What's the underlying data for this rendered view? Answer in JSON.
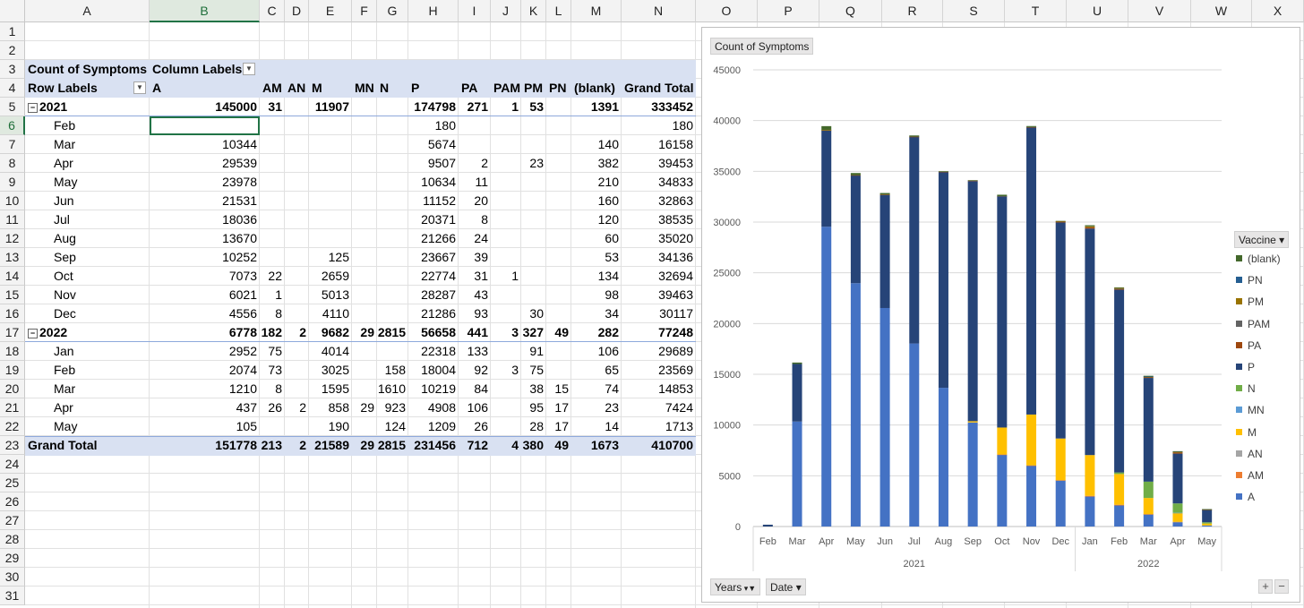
{
  "sheet": {
    "columns": [
      "A",
      "B",
      "C",
      "D",
      "E",
      "F",
      "G",
      "H",
      "I",
      "J",
      "K",
      "L",
      "M",
      "N",
      "O",
      "P",
      "Q",
      "R",
      "S",
      "T",
      "U",
      "V",
      "W",
      "X"
    ],
    "rows": [
      "1",
      "2",
      "3",
      "4",
      "5",
      "6",
      "7",
      "8",
      "9",
      "10",
      "11",
      "12",
      "13",
      "14",
      "15",
      "16",
      "17",
      "18",
      "19",
      "20",
      "21",
      "22",
      "23",
      "24",
      "25",
      "26",
      "27",
      "28",
      "29",
      "30",
      "31"
    ],
    "selected_column": "B",
    "selected_row": "6"
  },
  "pivot": {
    "count_label": "Count of Symptoms",
    "column_labels": "Column Labels",
    "row_labels": "Row Labels",
    "headers": [
      "A",
      "AM",
      "AN",
      "M",
      "MN",
      "N",
      "P",
      "PA",
      "PAM",
      "PM",
      "PN",
      "(blank)",
      "Grand Total"
    ],
    "rows": [
      {
        "label": "2021",
        "type": "year",
        "values": [
          "145000",
          "31",
          "",
          "11907",
          "",
          "",
          "174798",
          "271",
          "1",
          "53",
          "",
          "1391",
          "333452"
        ]
      },
      {
        "label": "Feb",
        "type": "month",
        "values": [
          "",
          "",
          "",
          "",
          "",
          "",
          "180",
          "",
          "",
          "",
          "",
          "",
          "180"
        ]
      },
      {
        "label": "Mar",
        "type": "month",
        "values": [
          "10344",
          "",
          "",
          "",
          "",
          "",
          "5674",
          "",
          "",
          "",
          "",
          "140",
          "16158"
        ]
      },
      {
        "label": "Apr",
        "type": "month",
        "values": [
          "29539",
          "",
          "",
          "",
          "",
          "",
          "9507",
          "2",
          "",
          "23",
          "",
          "382",
          "39453"
        ]
      },
      {
        "label": "May",
        "type": "month",
        "values": [
          "23978",
          "",
          "",
          "",
          "",
          "",
          "10634",
          "11",
          "",
          "",
          "",
          "210",
          "34833"
        ]
      },
      {
        "label": "Jun",
        "type": "month",
        "values": [
          "21531",
          "",
          "",
          "",
          "",
          "",
          "11152",
          "20",
          "",
          "",
          "",
          "160",
          "32863"
        ]
      },
      {
        "label": "Jul",
        "type": "month",
        "values": [
          "18036",
          "",
          "",
          "",
          "",
          "",
          "20371",
          "8",
          "",
          "",
          "",
          "120",
          "38535"
        ]
      },
      {
        "label": "Aug",
        "type": "month",
        "values": [
          "13670",
          "",
          "",
          "",
          "",
          "",
          "21266",
          "24",
          "",
          "",
          "",
          "60",
          "35020"
        ]
      },
      {
        "label": "Sep",
        "type": "month",
        "values": [
          "10252",
          "",
          "",
          "125",
          "",
          "",
          "23667",
          "39",
          "",
          "",
          "",
          "53",
          "34136"
        ]
      },
      {
        "label": "Oct",
        "type": "month",
        "values": [
          "7073",
          "22",
          "",
          "2659",
          "",
          "",
          "22774",
          "31",
          "1",
          "",
          "",
          "134",
          "32694"
        ]
      },
      {
        "label": "Nov",
        "type": "month",
        "values": [
          "6021",
          "1",
          "",
          "5013",
          "",
          "",
          "28287",
          "43",
          "",
          "",
          "",
          "98",
          "39463"
        ]
      },
      {
        "label": "Dec",
        "type": "month",
        "values": [
          "4556",
          "8",
          "",
          "4110",
          "",
          "",
          "21286",
          "93",
          "",
          "30",
          "",
          "34",
          "30117"
        ]
      },
      {
        "label": "2022",
        "type": "year",
        "values": [
          "6778",
          "182",
          "2",
          "9682",
          "29",
          "2815",
          "56658",
          "441",
          "3",
          "327",
          "49",
          "282",
          "77248"
        ]
      },
      {
        "label": "Jan",
        "type": "month",
        "values": [
          "2952",
          "75",
          "",
          "4014",
          "",
          "",
          "22318",
          "133",
          "",
          "91",
          "",
          "106",
          "29689"
        ]
      },
      {
        "label": "Feb",
        "type": "month",
        "values": [
          "2074",
          "73",
          "",
          "3025",
          "",
          "158",
          "18004",
          "92",
          "3",
          "75",
          "",
          "65",
          "23569"
        ]
      },
      {
        "label": "Mar",
        "type": "month",
        "values": [
          "1210",
          "8",
          "",
          "1595",
          "",
          "1610",
          "10219",
          "84",
          "",
          "38",
          "15",
          "74",
          "14853"
        ]
      },
      {
        "label": "Apr",
        "type": "month",
        "values": [
          "437",
          "26",
          "2",
          "858",
          "29",
          "923",
          "4908",
          "106",
          "",
          "95",
          "17",
          "23",
          "7424"
        ]
      },
      {
        "label": "May",
        "type": "month",
        "values": [
          "105",
          "",
          "",
          "190",
          "",
          "124",
          "1209",
          "26",
          "",
          "28",
          "17",
          "14",
          "1713"
        ]
      },
      {
        "label": "Grand Total",
        "type": "total",
        "values": [
          "151778",
          "213",
          "2",
          "21589",
          "29",
          "2815",
          "231456",
          "712",
          "4",
          "380",
          "49",
          "1673",
          "410700"
        ]
      }
    ],
    "collapse_glyph": "−",
    "dropdown_glyph": "▼",
    "filter_glyph": "▼"
  },
  "chart": {
    "field_button": "Count of Symptoms",
    "legend_title": "Vaccine",
    "axis_buttons": [
      "Years",
      "Date"
    ],
    "zoom_plus": "+",
    "zoom_minus": "−",
    "colors": {
      "A": "#4472c4",
      "AM": "#ed7d31",
      "AN": "#a5a5a5",
      "M": "#ffc000",
      "MN": "#5b9bd5",
      "N": "#70ad47",
      "P": "#264478",
      "PA": "#9e480e",
      "PAM": "#636363",
      "PM": "#997300",
      "PN": "#255e91",
      "(blank)": "#43682b"
    }
  },
  "chart_data": {
    "type": "bar",
    "stacked": true,
    "title": "",
    "xlabel": "",
    "ylabel": "",
    "ylim": [
      0,
      45000
    ],
    "yticks": [
      "0",
      "5000",
      "10000",
      "15000",
      "20000",
      "25000",
      "30000",
      "35000",
      "40000",
      "45000"
    ],
    "categories": [
      "Feb",
      "Mar",
      "Apr",
      "May",
      "Jun",
      "Jul",
      "Aug",
      "Sep",
      "Oct",
      "Nov",
      "Dec",
      "Jan",
      "Feb",
      "Mar",
      "Apr",
      "May"
    ],
    "groups": [
      {
        "label": "2021",
        "count": 11
      },
      {
        "label": "2022",
        "count": 5
      }
    ],
    "series": [
      {
        "name": "A",
        "values": [
          0,
          10344,
          29539,
          23978,
          21531,
          18036,
          13670,
          10252,
          7073,
          6021,
          4556,
          2952,
          2074,
          1210,
          437,
          105
        ]
      },
      {
        "name": "AM",
        "values": [
          0,
          0,
          0,
          0,
          0,
          0,
          0,
          0,
          22,
          1,
          8,
          75,
          73,
          8,
          26,
          0
        ]
      },
      {
        "name": "AN",
        "values": [
          0,
          0,
          0,
          0,
          0,
          0,
          0,
          0,
          0,
          0,
          0,
          0,
          0,
          0,
          2,
          0
        ]
      },
      {
        "name": "M",
        "values": [
          0,
          0,
          0,
          0,
          0,
          0,
          0,
          125,
          2659,
          5013,
          4110,
          4014,
          3025,
          1595,
          858,
          190
        ]
      },
      {
        "name": "MN",
        "values": [
          0,
          0,
          0,
          0,
          0,
          0,
          0,
          0,
          0,
          0,
          0,
          0,
          0,
          0,
          29,
          0
        ]
      },
      {
        "name": "N",
        "values": [
          0,
          0,
          0,
          0,
          0,
          0,
          0,
          0,
          0,
          0,
          0,
          0,
          158,
          1610,
          923,
          124
        ]
      },
      {
        "name": "P",
        "values": [
          180,
          5674,
          9507,
          10634,
          11152,
          20371,
          21266,
          23667,
          22774,
          28287,
          21286,
          22318,
          18004,
          10219,
          4908,
          1209
        ]
      },
      {
        "name": "PA",
        "values": [
          0,
          0,
          2,
          11,
          20,
          8,
          24,
          39,
          31,
          43,
          93,
          133,
          92,
          84,
          106,
          26
        ]
      },
      {
        "name": "PAM",
        "values": [
          0,
          0,
          0,
          0,
          0,
          0,
          0,
          0,
          1,
          0,
          0,
          0,
          3,
          0,
          0,
          0
        ]
      },
      {
        "name": "PM",
        "values": [
          0,
          0,
          23,
          0,
          0,
          0,
          0,
          0,
          0,
          0,
          30,
          91,
          75,
          38,
          95,
          28
        ]
      },
      {
        "name": "PN",
        "values": [
          0,
          0,
          0,
          0,
          0,
          0,
          0,
          0,
          0,
          0,
          0,
          0,
          0,
          15,
          17,
          17
        ]
      },
      {
        "name": "(blank)",
        "values": [
          0,
          140,
          382,
          210,
          160,
          120,
          60,
          53,
          134,
          98,
          34,
          106,
          65,
          74,
          23,
          14
        ]
      }
    ],
    "legend_order": [
      "(blank)",
      "PN",
      "PM",
      "PAM",
      "PA",
      "P",
      "N",
      "MN",
      "M",
      "AN",
      "AM",
      "A"
    ],
    "legend_position": "right",
    "grid": true
  }
}
